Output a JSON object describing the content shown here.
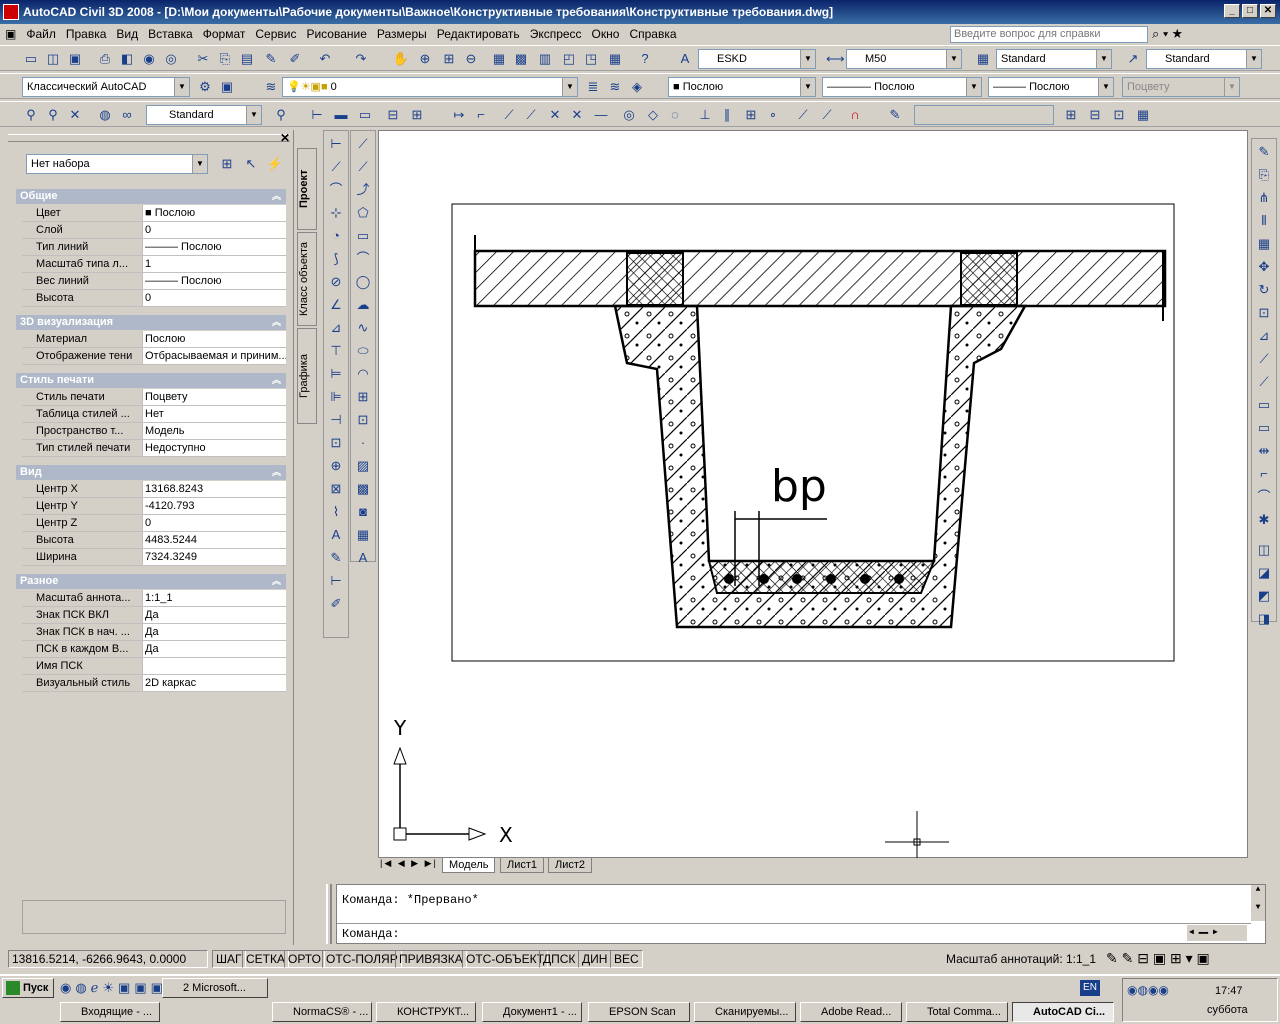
{
  "title": "AutoCAD Civil 3D 2008 - [D:\\Мои документы\\Рабочие документы\\Важное\\Конструктивные требования\\Конструктивные требования.dwg]",
  "menu": [
    "Файл",
    "Правка",
    "Вид",
    "Вставка",
    "Формат",
    "Сервис",
    "Рисование",
    "Размеры",
    "Редактировать",
    "Экспресс",
    "Окно",
    "Справка"
  ],
  "help_placeholder": "Введите вопрос для справки",
  "toolbar": {
    "text_style": "ESKD",
    "dim_style": "M50",
    "table_style": "Standard",
    "ml_style": "Standard",
    "workspace": "Классический AutoCAD",
    "layer": "0",
    "color": "Послою",
    "linetype": "Послою",
    "lineweight": "Послою",
    "plotstyle": "Поцвету",
    "view_style": "Standard"
  },
  "palette": {
    "selection": "Нет набора",
    "sections": [
      {
        "title": "Общие",
        "rows": [
          [
            "Цвет",
            "■ Послою"
          ],
          [
            "Слой",
            "0"
          ],
          [
            "Тип линий",
            "——— Послою"
          ],
          [
            "Масштаб типа л...",
            "1"
          ],
          [
            "Вес линий",
            "——— Послою"
          ],
          [
            "Высота",
            "0"
          ]
        ]
      },
      {
        "title": "3D визуализация",
        "rows": [
          [
            "Материал",
            "Послою"
          ],
          [
            "Отображение тени",
            "Отбрасываемая и приним..."
          ]
        ]
      },
      {
        "title": "Стиль печати",
        "rows": [
          [
            "Стиль печати",
            "Поцвету"
          ],
          [
            "Таблица стилей ...",
            "Нет"
          ],
          [
            "Пространство т...",
            "Модель"
          ],
          [
            "Тип стилей печати",
            "Недоступно"
          ]
        ]
      },
      {
        "title": "Вид",
        "rows": [
          [
            "Центр X",
            "13168.8243"
          ],
          [
            "Центр Y",
            "-4120.793"
          ],
          [
            "Центр Z",
            "0"
          ],
          [
            "Высота",
            "4483.5244"
          ],
          [
            "Ширина",
            "7324.3249"
          ]
        ]
      },
      {
        "title": "Разное",
        "rows": [
          [
            "Масштаб аннота...",
            "1:1_1"
          ],
          [
            "Знак ПСК ВКЛ",
            "Да"
          ],
          [
            "Знак ПСК в нач. ...",
            "Да"
          ],
          [
            "ПСК в каждом В...",
            "Да"
          ],
          [
            "Имя ПСК",
            ""
          ],
          [
            "Визуальный стиль",
            "2D каркас"
          ]
        ]
      }
    ],
    "tabs": [
      "Проект",
      "Класс объекта",
      "Графика"
    ]
  },
  "drawing": {
    "label": "bp",
    "ucs_x": "X",
    "ucs_y": "Y"
  },
  "layout_tabs": [
    "Модель",
    "Лист1",
    "Лист2"
  ],
  "command": {
    "line1": "Команда: *Прервано*",
    "line2": "Команда:"
  },
  "status": {
    "coords": "13816.5214, -6266.9643, 0.0000",
    "buttons": [
      "ШАГ",
      "СЕТКА",
      "ОРТО",
      "ОТС-ПОЛЯР",
      "ПРИВЯЗКА",
      "ОТС-ОБЪЕКТ",
      "ДПСК",
      "ДИН",
      "ВЕС"
    ],
    "annotation": "Масштаб аннотаций: 1:1_1"
  },
  "taskbar": {
    "start": "Пуск",
    "row1": [
      "Входящие - ...",
      "2 Microsoft...",
      "NormaCS® - ...",
      "КОНСТРУКТ...",
      "Документ1 - ...",
      "EPSON Scan",
      "Сканируемы...",
      "Adobe Read...",
      "Total Comma...",
      "AutoCAD Ci..."
    ],
    "lang": "EN",
    "time": "17:47",
    "day": "суббота"
  }
}
